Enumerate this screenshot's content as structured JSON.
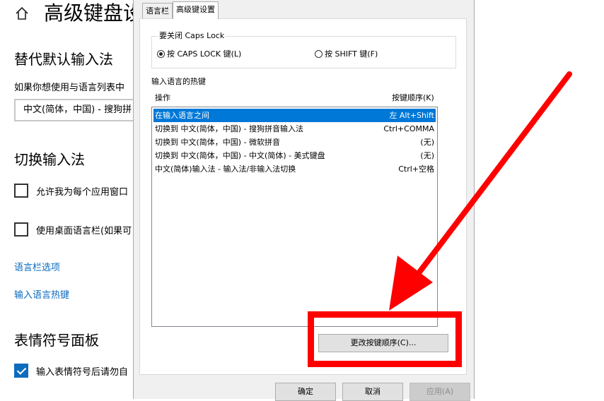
{
  "settings": {
    "page_title": "高级键盘设",
    "override_section_title": "替代默认输入法",
    "override_desc": "如果你想使用与语言列表中",
    "override_combo_value": "中文(简体，中国) - 搜狗拼",
    "switch_section_title": "切换输入法",
    "checkbox_per_app": "允许我为每个应用窗口",
    "checkbox_desktop_bar": "使用桌面语言栏(如果可",
    "link_langbar_options": "语言栏选项",
    "link_hotkeys": "输入语言热键",
    "emoji_section_title": "表情符号面板",
    "checkbox_emoji": "输入表情符号后请勿自"
  },
  "dialog": {
    "tabs": [
      {
        "label": "语言栏",
        "active": false
      },
      {
        "label": "高级键设置",
        "active": true
      }
    ],
    "caps_group": {
      "legend": "要关闭 Caps Lock",
      "option_caps": "按 CAPS LOCK 键(L)",
      "option_shift": "按 SHIFT 键(F)",
      "selected": "caps"
    },
    "hotkey_group": {
      "legend": "输入语言的热键",
      "col_action": "操作",
      "col_keys": "按键顺序(K)",
      "rows": [
        {
          "action": "在输入语言之间",
          "keys": "左 Alt+Shift",
          "selected": true
        },
        {
          "action": "切换到 中文(简体，中国) - 搜狗拼音输入法",
          "keys": "Ctrl+COMMA",
          "selected": false
        },
        {
          "action": "切换到 中文(简体，中国) - 微软拼音",
          "keys": "(无)",
          "selected": false
        },
        {
          "action": "切换到 中文(简体，中国) - 中文(简体) - 美式键盘",
          "keys": "(无)",
          "selected": false
        },
        {
          "action": "中文(简体)输入法 - 输入法/非输入法切换",
          "keys": "Ctrl+空格",
          "selected": false
        }
      ],
      "change_button": "更改按键顺序(C)..."
    },
    "buttons": {
      "ok": "确定",
      "cancel": "取消",
      "apply": "应用(A)"
    }
  },
  "colors": {
    "accent": "#0078d7",
    "annotation": "#ff0000",
    "link": "#0a6abf"
  }
}
